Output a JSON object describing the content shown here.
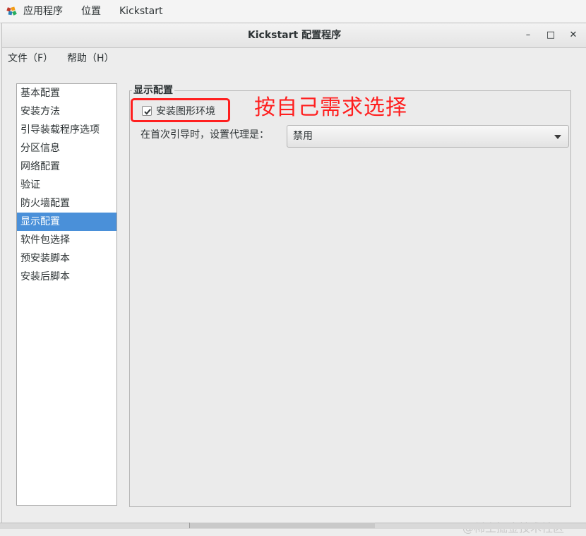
{
  "topbar": {
    "apps_label": "应用程序",
    "places_label": "位置",
    "app_name": "Kickstart"
  },
  "window": {
    "title": "Kickstart 配置程序",
    "controls": {
      "minimize": "–",
      "maximize": "□",
      "close": "✕"
    }
  },
  "menubar": {
    "file": "文件（F）",
    "help": "帮助（H）"
  },
  "sidebar": {
    "selected_index": 7,
    "items": [
      {
        "label": "基本配置"
      },
      {
        "label": "安装方法"
      },
      {
        "label": "引导装载程序选项"
      },
      {
        "label": "分区信息"
      },
      {
        "label": "网络配置"
      },
      {
        "label": "验证"
      },
      {
        "label": "防火墙配置"
      },
      {
        "label": "显示配置"
      },
      {
        "label": "软件包选择"
      },
      {
        "label": "预安装脚本"
      },
      {
        "label": "安装后脚本"
      }
    ]
  },
  "panel": {
    "title": "显示配置",
    "checkbox_label": "安装图形环境",
    "checkbox_checked": true,
    "proxy_label": "在首次引导时，设置代理是：",
    "proxy_value": "禁用"
  },
  "annotation": {
    "text": "按自己需求选择",
    "color": "#ff1f1f"
  },
  "watermark": "@稀土掘金技术社区",
  "colors": {
    "selection": "#4a90d9",
    "annotation": "#ff1f1f"
  }
}
